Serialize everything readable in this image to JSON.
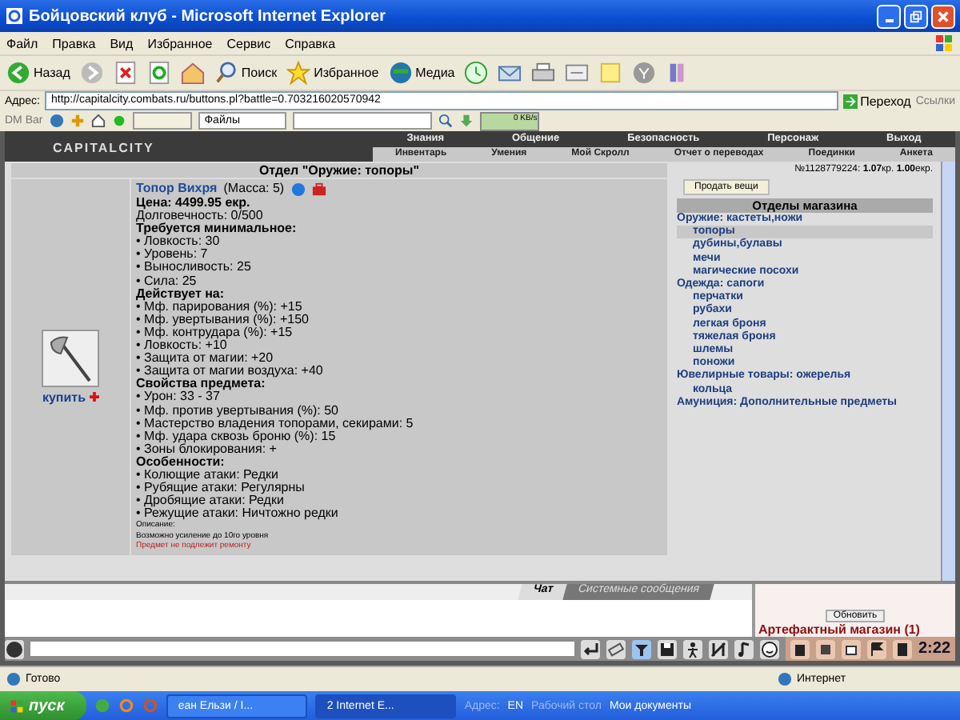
{
  "window": {
    "title": "Бойцовский клуб - Microsoft Internet Explorer"
  },
  "menu": [
    "Файл",
    "Правка",
    "Вид",
    "Избранное",
    "Сервис",
    "Справка"
  ],
  "toolbar": {
    "back": "Назад",
    "search": "Поиск",
    "favorites": "Избранное",
    "media": "Медиа"
  },
  "address_bar": {
    "label": "Адрес:",
    "value": "http://capitalcity.combats.ru/buttons.pl?battle=0.703216020570942",
    "go": "Переход",
    "links": "Ссылки"
  },
  "dm_bar": {
    "label": "DM Bar",
    "files": "Файлы",
    "speed": "0 KB/s"
  },
  "game": {
    "logo": "CAPITALCITY",
    "nav_top": [
      "Знания",
      "Общение",
      "Безопасность",
      "Персонаж",
      "Выход"
    ],
    "nav_bottom": [
      "Инвентарь",
      "Умения",
      "Мой Скролл",
      "Отчет о переводах",
      "Поединки",
      "Анкета"
    ]
  },
  "shop": {
    "department_title": "Отдел \"Оружие: топоры\"",
    "buy": "купить",
    "item": {
      "name": "Топор Вихря",
      "mass": "(Масса: 5)",
      "lines": [
        {
          "kind": "price",
          "text": "Цена: 4499.95 екр."
        },
        {
          "kind": "plain",
          "text": "Долговечность: 0/500"
        },
        {
          "kind": "heading",
          "text": "Требуется минимальное:"
        },
        {
          "kind": "bullet",
          "text": "• Ловкость: 30"
        },
        {
          "kind": "bullet",
          "text": "• Уровень: 7"
        },
        {
          "kind": "bullet",
          "text": "• Выносливость: 25"
        },
        {
          "kind": "bullet",
          "text": "• Сила: 25"
        },
        {
          "kind": "heading",
          "text": "Действует на:"
        },
        {
          "kind": "bullet",
          "text": "• Мф. парирования (%): +15"
        },
        {
          "kind": "bullet",
          "text": "• Мф. увертывания (%): +150"
        },
        {
          "kind": "bullet",
          "text": "• Мф. контрудара (%): +15"
        },
        {
          "kind": "bullet",
          "text": "• Ловкость: +10"
        },
        {
          "kind": "bullet",
          "text": "• Защита от магии: +20"
        },
        {
          "kind": "bullet",
          "text": "• Защита от магии воздуха: +40"
        },
        {
          "kind": "heading",
          "text": "Свойства предмета:"
        },
        {
          "kind": "bullet",
          "text": "• Урон: 33 - 37"
        },
        {
          "kind": "bullet",
          "text": "• Мф. против увертывания (%): 50"
        },
        {
          "kind": "bullet",
          "text": "• Мастерство владения топорами, секирами: 5"
        },
        {
          "kind": "bullet",
          "text": "• Мф. удара сквозь броню (%): 15"
        },
        {
          "kind": "bullet",
          "text": "• Зоны блокирования: +"
        },
        {
          "kind": "heading",
          "text": "Особенности:"
        },
        {
          "kind": "bullet",
          "text": "• Колющие атаки: Редки"
        },
        {
          "kind": "bullet",
          "text": "• Рубящие атаки: Регулярны"
        },
        {
          "kind": "bullet",
          "text": "• Дробящие атаки: Редки"
        },
        {
          "kind": "bullet",
          "text": "• Режущие атаки: Ничтожно редки"
        },
        {
          "kind": "small",
          "text": "Описание:"
        },
        {
          "kind": "small",
          "text": "Возможно усиление до 10го уровня"
        },
        {
          "kind": "warning",
          "text": "Предмет не подлежит ремонту"
        }
      ]
    },
    "balance": "№1128779224: **1.07**кр. **1.00**екр.",
    "sell_button": "Продать вещи",
    "departments_title": "Отделы магазина",
    "departments": [
      {
        "text": "Оружие: кастеты,ножи",
        "selected": false,
        "children": [
          {
            "text": "топоры",
            "selected": true
          },
          {
            "text": "дубины,булавы",
            "selected": false
          },
          {
            "text": "мечи",
            "selected": false
          },
          {
            "text": "магические посохи",
            "selected": false
          }
        ]
      },
      {
        "text": "Одежда: сапоги",
        "selected": false,
        "children": [
          {
            "text": "перчатки",
            "selected": false
          },
          {
            "text": "рубахи",
            "selected": false
          },
          {
            "text": "легкая броня",
            "selected": false
          },
          {
            "text": "тяжелая броня",
            "selected": false
          },
          {
            "text": "шлемы",
            "selected": false
          },
          {
            "text": "поножи",
            "selected": false
          }
        ]
      },
      {
        "text": "Ювелирные товары: ожерелья",
        "selected": false,
        "children": [
          {
            "text": "кольца",
            "selected": false
          }
        ]
      },
      {
        "text": "Амуниция: Дополнительные предметы",
        "selected": false
      }
    ]
  },
  "chat": {
    "tabs": [
      {
        "label": "Чат",
        "selected": true
      },
      {
        "label": "Системные сообщения",
        "selected": false
      }
    ],
    "refresh": "Обновить",
    "room": "Артефактный магазин (1)",
    "clock": "2:22"
  },
  "status_bar": {
    "text": "Готово",
    "zone": "Интернет"
  },
  "taskbar": {
    "start": "пуск",
    "tasks": [
      "еан Ельзи / I...",
      "2 Internet E..."
    ],
    "address": "Адрес:",
    "lang": "EN",
    "desktop": "Рабочий стол",
    "docs": "Мои документы"
  }
}
